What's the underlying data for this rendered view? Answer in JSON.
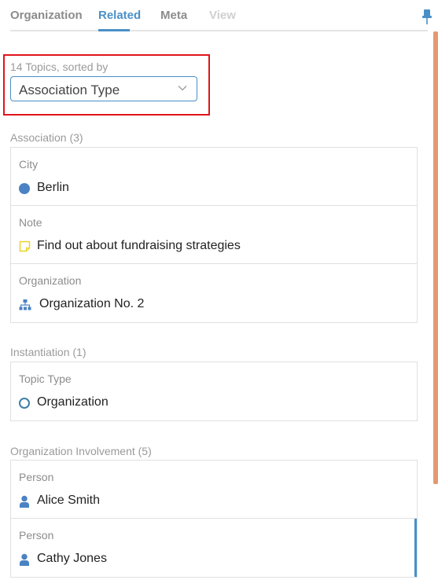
{
  "tabs": [
    {
      "label": "Organization"
    },
    {
      "label": "Related"
    },
    {
      "label": "Meta"
    },
    {
      "label": "View"
    }
  ],
  "sort": {
    "label": "14 Topics, sorted by",
    "value": "Association Type"
  },
  "groups": [
    {
      "title": "Association (3)",
      "items": [
        {
          "type": "City",
          "name": "Berlin",
          "icon": "circle-filled-icon"
        },
        {
          "type": "Note",
          "name": "Find out about fundraising strategies",
          "icon": "note-icon"
        },
        {
          "type": "Organization",
          "name": "Organization No. 2",
          "icon": "sitemap-icon"
        }
      ]
    },
    {
      "title": "Instantiation (1)",
      "items": [
        {
          "type": "Topic Type",
          "name": "Organization",
          "icon": "circle-outline-icon"
        }
      ]
    },
    {
      "title": "Organization Involvement (5)",
      "items": [
        {
          "type": "Person",
          "name": "Alice Smith",
          "icon": "user-icon"
        },
        {
          "type": "Person",
          "name": "Cathy Jones",
          "icon": "user-icon"
        }
      ]
    }
  ],
  "colors": {
    "accent": "#4a90c8",
    "highlight_frame": "#e0151b",
    "scrollbar": "#e49a6c",
    "note_icon": "#e8d52a"
  }
}
